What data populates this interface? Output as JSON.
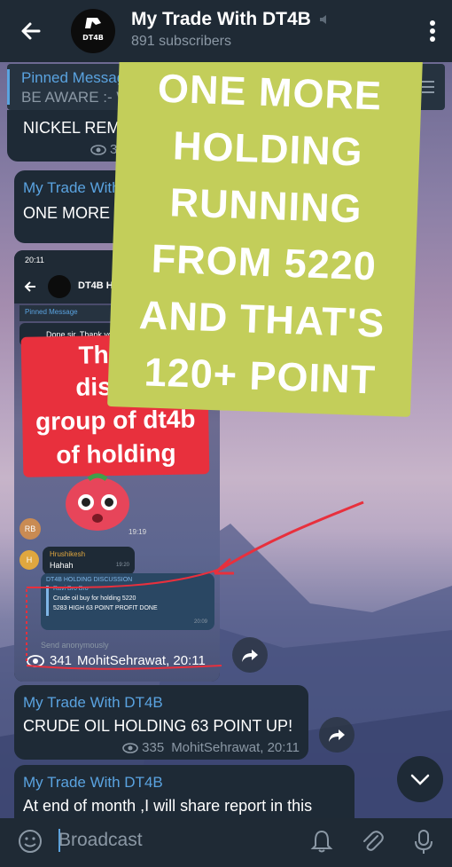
{
  "header": {
    "title": "My Trade With DT4B",
    "subtitle": "891 subscribers",
    "avatar_text": "DT4B"
  },
  "pinned": {
    "title": "Pinned Messag",
    "snippet": "BE AWARE :- W"
  },
  "messages": [
    {
      "text": "NICKEL REM",
      "views": "338"
    },
    {
      "from": "My Trade With",
      "text": "ONE MORE I"
    }
  ],
  "screenshot": {
    "status_time": "20:11",
    "title": "DT4B HOL",
    "pinned": "Pinned Message",
    "reply_text": "Done sir, Thank yo",
    "red_text": [
      "This s",
      "discus",
      "group of dt4b",
      "of holding"
    ],
    "rb_initials": "RB",
    "time1": "19:19",
    "h_initial": "H",
    "h_name": "Hrushikesh",
    "h_text": "Hahah",
    "h_time": "19:20",
    "fwd_header": "DT4B HOLDING DISCUSSION",
    "fwd_from": "Ravi Bro Bro",
    "fwd_line1": "Crude oil buy for holding 5220",
    "fwd_line2": "5283 HIGH 63 POINT PROFIT DONE",
    "fwd_time": "20:09",
    "input_placeholder": "Send anonymously"
  },
  "screenshot_meta": {
    "views": "341",
    "author_time": "MohitSehrawat, 20:11"
  },
  "message3": {
    "from": "My Trade With DT4B",
    "text": "CRUDE OIL HOLDING 63 POINT UP!",
    "views": "335",
    "author_time": "MohitSehrawat, 20:11"
  },
  "message4": {
    "from": "My Trade With DT4B",
    "text": "At end of month ,I will share report in this"
  },
  "sticker": {
    "lines": [
      "ONE MORE",
      "HOLDING",
      "RUNNING",
      "FROM 5220",
      "AND THAT'S",
      "120+ POINT"
    ]
  },
  "input": {
    "placeholder": "Broadcast"
  },
  "colors": {
    "accent": "#5aa3e0",
    "sticker": "#c3ce5a",
    "red_card": "#e8303d",
    "header": "#1f2a35",
    "bubble": "#1e2a36"
  }
}
